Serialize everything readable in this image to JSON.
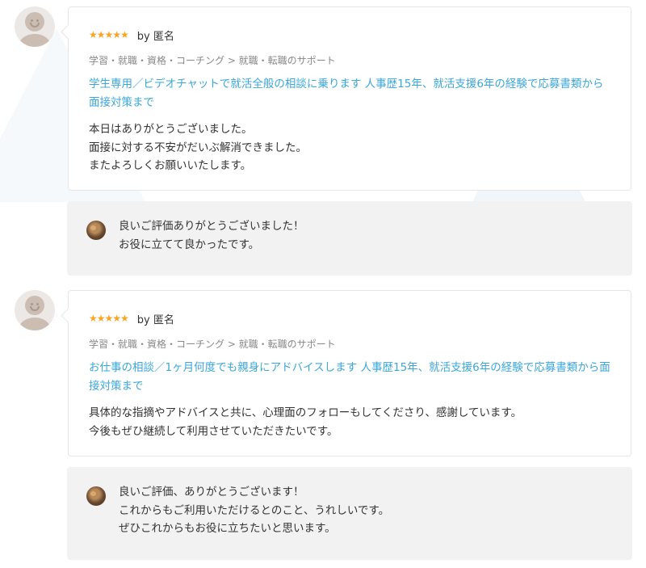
{
  "reviews": [
    {
      "rating": 5,
      "stars": "★★★★★",
      "by": "by 匿名",
      "category": "学習・就職・資格・コーチング > 就職・転職のサポート",
      "service_title": "学生専用／ビデオチャットで就活全般の相談に乗ります 人事歴15年、就活支援6年の経験で応募書類から面接対策まで",
      "comment": "本日はありがとうございました。\n面接に対する不安がだいぶ解消できました。\nまたよろしくお願いいたします。",
      "reply": "良いご評価ありがとうございました！\nお役に立てて良かったです。"
    },
    {
      "rating": 5,
      "stars": "★★★★★",
      "by": "by 匿名",
      "category": "学習・就職・資格・コーチング > 就職・転職のサポート",
      "service_title": "お仕事の相談／1ヶ月何度でも親身にアドバイスします 人事歴15年、就活支援6年の経験で応募書類から面接対策まで",
      "comment": "具体的な指摘やアドバイスと共に、心理面のフォローもしてくださり、感謝しています。\n今後もぜひ継続して利用させていただきたいです。",
      "reply": "良いご評価、ありがとうございます！\nこれからもご利用いただけるとのこと、うれしいです。\nぜひこれからもお役に立ちたいと思います。"
    }
  ],
  "colors": {
    "star": "#f5a623",
    "link": "#3ba7d9",
    "reply_bg": "#f2f2f2"
  },
  "icons": {
    "reviewer_avatar": "default-user-avatar-icon",
    "seller_avatar": "seller-photo-avatar",
    "star": "star-icon"
  }
}
